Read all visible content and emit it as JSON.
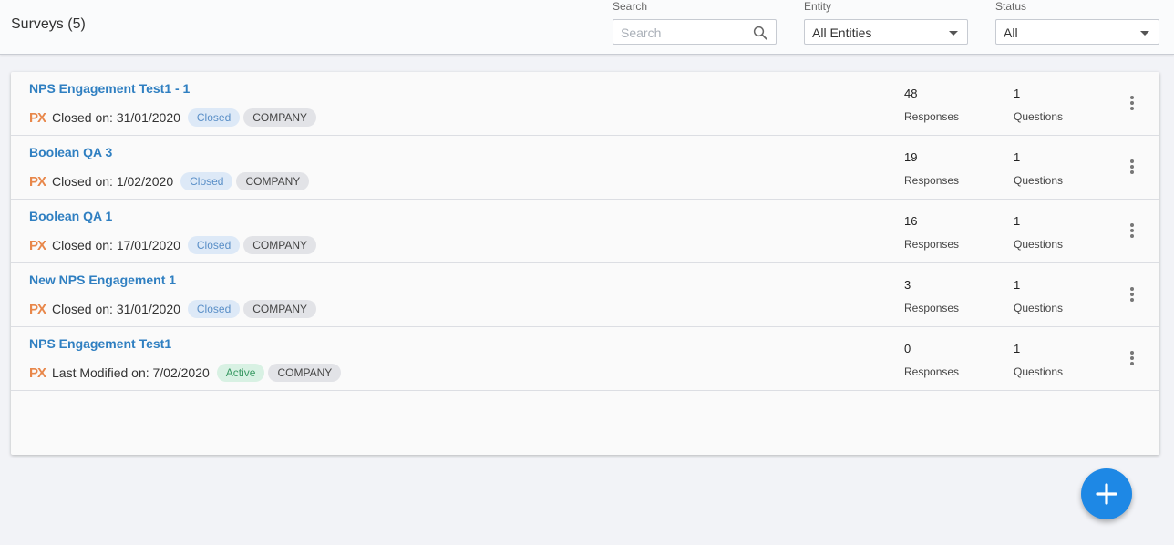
{
  "header": {
    "title": "Surveys (5)",
    "search": {
      "label": "Search",
      "placeholder": "Search"
    },
    "entity": {
      "label": "Entity",
      "value": "All Entities"
    },
    "status": {
      "label": "Status",
      "value": "All"
    }
  },
  "icons": {
    "search": "search-icon",
    "dropdown": "chevron-down-icon",
    "more": "more-vertical-icon",
    "add": "plus-icon"
  },
  "colors": {
    "link": "#2f7fc1",
    "brand_px": "#e8874a",
    "closed_badge": "#dde9f7",
    "active_badge": "#d8f1e3",
    "fab": "#1e88e5"
  },
  "labels": {
    "responses": "Responses",
    "questions": "Questions"
  },
  "surveys": [
    {
      "name": "NPS Engagement Test1 - 1",
      "logo": "PX",
      "date_text": "Closed on: 31/01/2020",
      "status": "Closed",
      "status_type": "closed",
      "tag": "COMPANY",
      "responses": "48",
      "questions": "1"
    },
    {
      "name": "Boolean QA 3",
      "logo": "PX",
      "date_text": "Closed on: 1/02/2020",
      "status": "Closed",
      "status_type": "closed",
      "tag": "COMPANY",
      "responses": "19",
      "questions": "1"
    },
    {
      "name": "Boolean QA 1",
      "logo": "PX",
      "date_text": "Closed on: 17/01/2020",
      "status": "Closed",
      "status_type": "closed",
      "tag": "COMPANY",
      "responses": "16",
      "questions": "1"
    },
    {
      "name": "New NPS Engagement 1",
      "logo": "PX",
      "date_text": "Closed on: 31/01/2020",
      "status": "Closed",
      "status_type": "closed",
      "tag": "COMPANY",
      "responses": "3",
      "questions": "1"
    },
    {
      "name": "NPS Engagement Test1",
      "logo": "PX",
      "date_text": "Last Modified on: 7/02/2020",
      "status": "Active",
      "status_type": "active",
      "tag": "COMPANY",
      "responses": "0",
      "questions": "1"
    }
  ]
}
